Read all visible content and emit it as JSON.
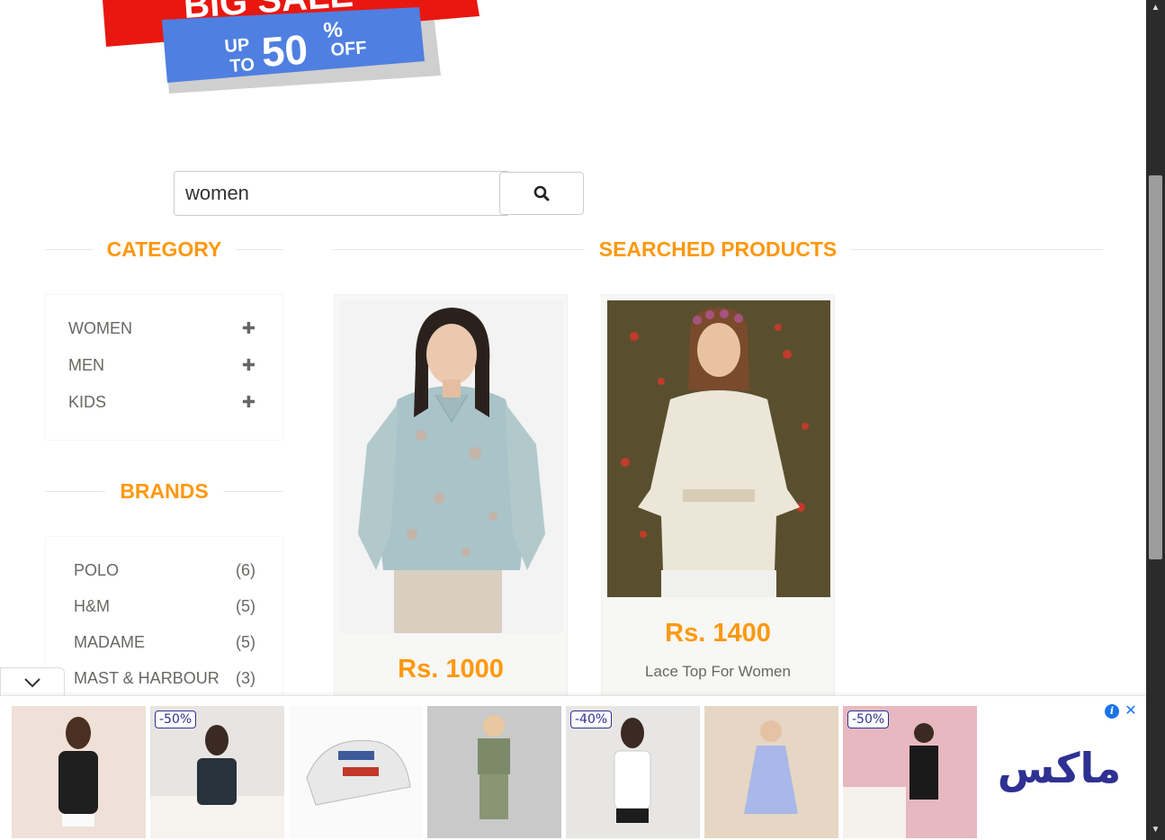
{
  "banner": {
    "line1": "BIG SALE",
    "up": "UP",
    "to": "TO",
    "percent": "50",
    "pct_sign": "%",
    "off": "OFF"
  },
  "search": {
    "value": "women",
    "icon": "search-icon"
  },
  "category": {
    "title": "CATEGORY",
    "items": [
      {
        "label": "WOMEN",
        "icon": "plus-icon"
      },
      {
        "label": "MEN",
        "icon": "plus-icon"
      },
      {
        "label": "KIDS",
        "icon": "plus-icon"
      }
    ]
  },
  "brands": {
    "title": "BRANDS",
    "items": [
      {
        "label": "POLO",
        "count": "(6)"
      },
      {
        "label": "H&M",
        "count": "(5)"
      },
      {
        "label": "MADAME",
        "count": "(5)"
      },
      {
        "label": "MAST & HARBOUR",
        "count": "(3)"
      }
    ]
  },
  "products": {
    "title": "SEARCHED PRODUCTS",
    "items": [
      {
        "price": "Rs. 1000",
        "name": ""
      },
      {
        "price": "Rs. 1400",
        "name": "Lace Top For Women"
      }
    ]
  },
  "ad": {
    "badges": [
      "-50%",
      "-40%",
      "-50%"
    ],
    "logo": "ماكس",
    "info_icon": "info-icon",
    "close_icon": "close-icon",
    "collapse_icon": "chevron-down-icon"
  },
  "colors": {
    "accent": "#fe980f",
    "text": "#696763",
    "ad_brand": "#2e3192"
  }
}
